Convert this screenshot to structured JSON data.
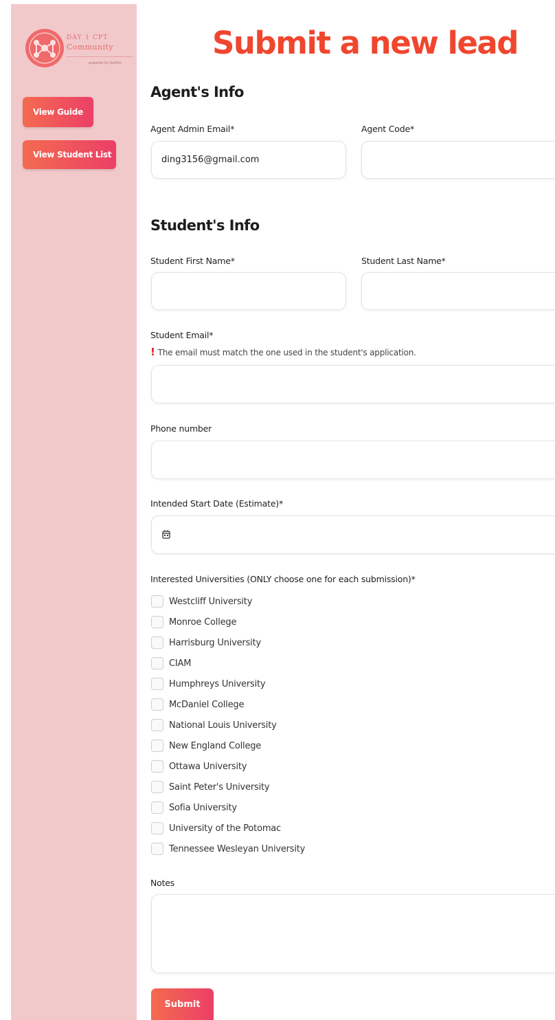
{
  "sidebar": {
    "logo": {
      "line1": "DAY 1 CPT",
      "line2": "Community",
      "powered": "powered by GoOlin"
    },
    "buttons": {
      "guide": "View Guide",
      "student_list": "View Student List"
    }
  },
  "main": {
    "title": "Submit a new lead"
  },
  "agent": {
    "title": "Agent's Info",
    "email_label": "Agent Admin Email*",
    "email_value": "ding3156@gmail.com",
    "code_label": "Agent Code*",
    "code_value": ""
  },
  "student": {
    "title": "Student's Info",
    "first_name_label": "Student First Name*",
    "last_name_label": "Student Last Name*",
    "email_label": "Student Email*",
    "email_hint_mark": "!",
    "email_hint": "The email must match the one used in the student's application.",
    "phone_label": "Phone number",
    "start_date_label": "Intended Start Date (Estimate)*",
    "universities_label": "Interested Universities (ONLY choose one for each submission)*",
    "universities": [
      "Westcliff University",
      "Monroe College",
      "Harrisburg University",
      "CIAM",
      "Humphreys University",
      "McDaniel College",
      "National Louis University",
      "New England College",
      "Ottawa University",
      "Saint Peter's University",
      "Sofia University",
      "University of the Potomac",
      "Tennessee Wesleyan University"
    ],
    "notes_label": "Notes"
  },
  "form": {
    "submit_label": "Submit"
  },
  "colors": {
    "sidebar_bg": "#f2c9cb",
    "title_orange": "#f0462e",
    "button_gradient_start": "#f36b50",
    "button_gradient_end": "#ec3f67"
  }
}
